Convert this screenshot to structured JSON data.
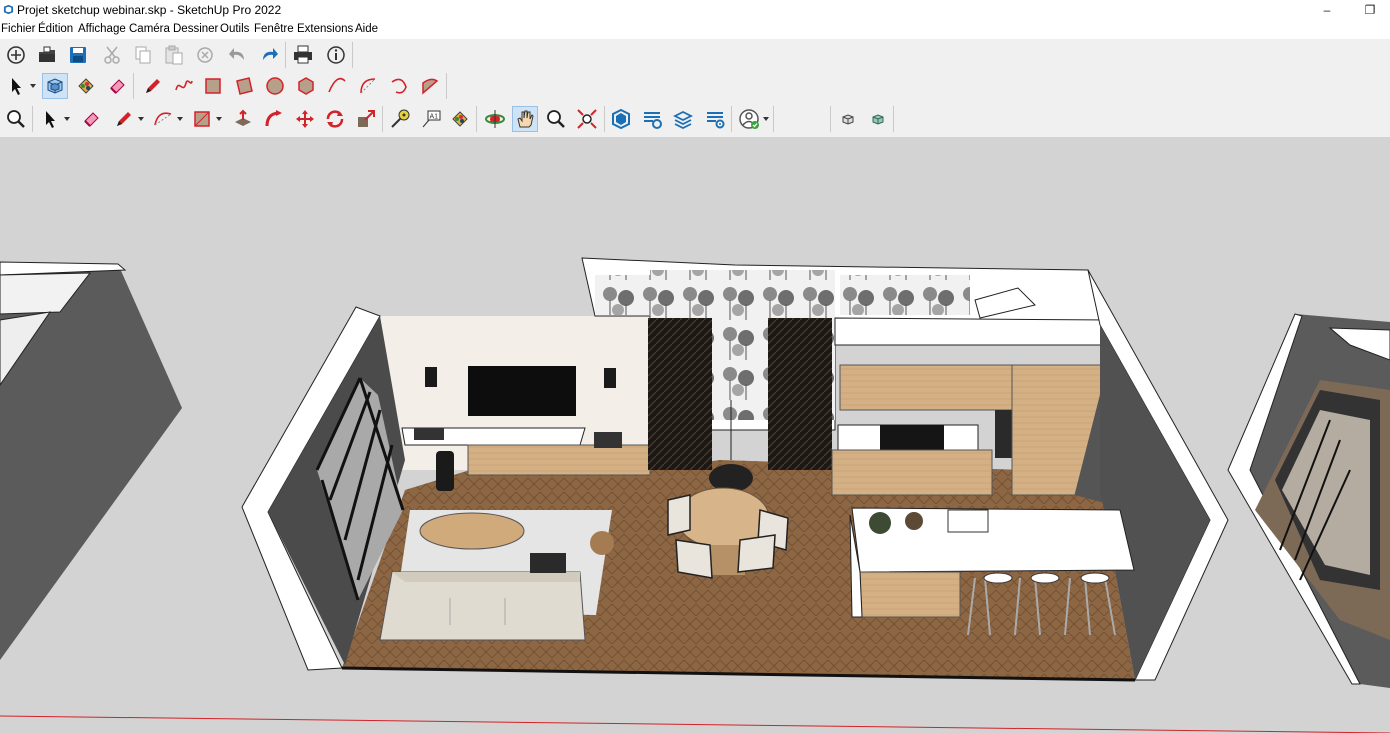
{
  "window": {
    "title": "Projet sketchup webinar.skp - SketchUp Pro 2022",
    "minimize_glyph": "–",
    "maximize_glyph": "❐"
  },
  "menu": {
    "items": [
      "Fichier",
      "Édition",
      "Affichage",
      "Caméra",
      "Dessiner",
      "Outils",
      "Fenêtre",
      "Extensions",
      "Aide"
    ]
  },
  "toolbars": {
    "row1": [
      "new-file-icon",
      "open-file-icon",
      "save-icon",
      "cut-icon",
      "copy-icon",
      "paste-icon",
      "erase-x-icon",
      "undo-icon",
      "redo-icon",
      "print-icon",
      "model-info-icon"
    ],
    "row2": [
      "select-arrow-icon",
      "make-component-icon",
      "paint-bucket-icon",
      "eraser-icon",
      "pencil-icon",
      "freehand-icon",
      "rectangle-icon",
      "rotated-rectangle-icon",
      "circle-icon",
      "polygon-icon",
      "arc-icon",
      "two-point-arc-icon",
      "three-point-arc-icon",
      "pie-icon"
    ],
    "row3": [
      "zoom-icon",
      "select-arrow-icon",
      "eraser-icon",
      "pencil-icon",
      "arc-icon",
      "rectangle-icon",
      "push-pull-icon",
      "follow-me-icon",
      "move-icon",
      "rotate-icon",
      "scale-icon",
      "tape-measure-icon",
      "text-label-icon",
      "paint-bucket-icon",
      "orbit-icon",
      "pan-icon",
      "zoom-icon",
      "zoom-extents-icon",
      "warehouse-icon",
      "extension-warehouse-icon",
      "layout-icon",
      "extension-manager-icon",
      "account-icon",
      "view-iso-icon",
      "view-top-icon"
    ],
    "text_label_glyph": "A1"
  },
  "colors": {
    "toolbar_bg": "#f0f0f0",
    "viewport_bg": "#d3d3d3",
    "wall_top": "#ffffff",
    "wall_dark": "#5a5a5a",
    "floor": "#8b6443",
    "cabinet_wood": "#d7b58a",
    "accent_red": "#d2232a",
    "accent_blue": "#1a6fb5"
  }
}
